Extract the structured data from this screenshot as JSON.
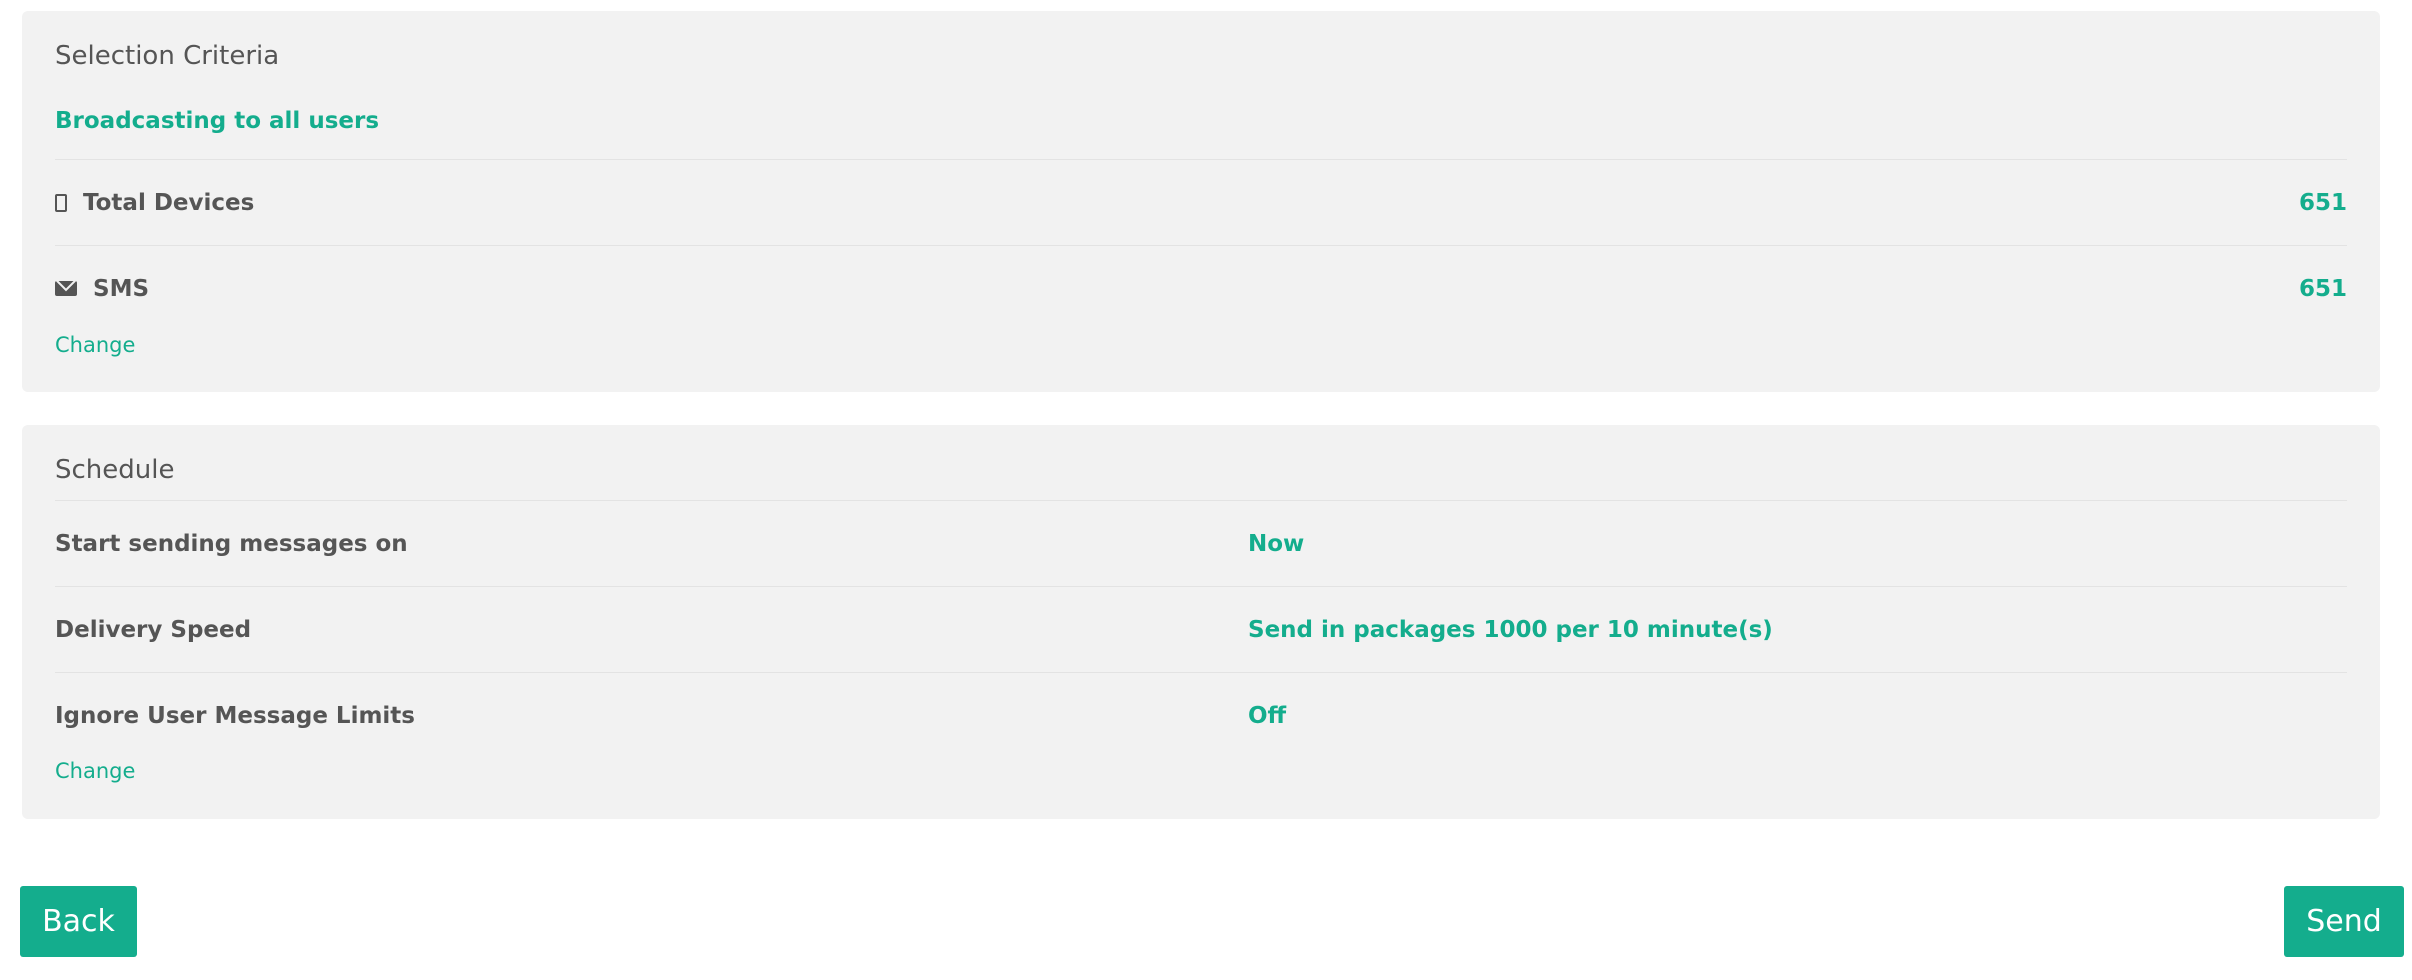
{
  "selection_criteria": {
    "title": "Selection Criteria",
    "subtitle": "Broadcasting to all users",
    "rows": [
      {
        "icon": "phone-icon",
        "label": "Total Devices",
        "count": "651"
      },
      {
        "icon": "envelope-icon",
        "label": "SMS",
        "count": "651"
      }
    ],
    "change_label": "Change"
  },
  "schedule": {
    "title": "Schedule",
    "rows": [
      {
        "label": "Start sending messages on",
        "value": "Now"
      },
      {
        "label": "Delivery Speed",
        "value": "Send in packages 1000 per 10 minute(s)"
      },
      {
        "label": "Ignore User Message Limits",
        "value": "Off"
      }
    ],
    "change_label": "Change"
  },
  "actions": {
    "back_label": "Back",
    "send_label": "Send"
  },
  "colors": {
    "accent": "#14ad8d",
    "panel_bg": "#f2f2f2",
    "text": "#555555"
  }
}
